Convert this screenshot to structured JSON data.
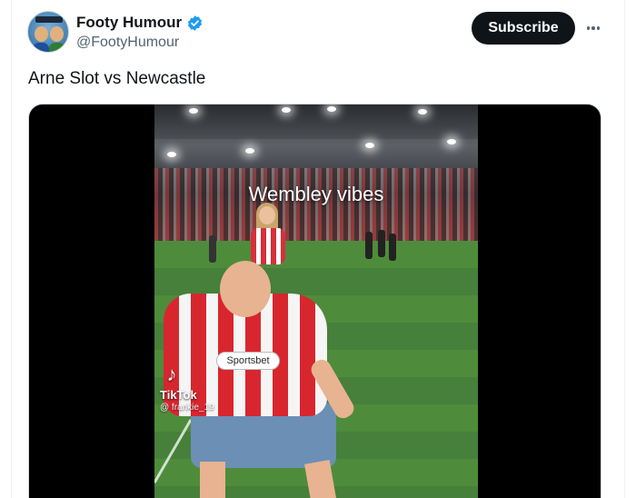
{
  "author": {
    "display_name": "Footy Humour",
    "handle": "@FootyHumour",
    "verified": true
  },
  "actions": {
    "subscribe_label": "Subscribe",
    "more_icon": "more-horizontal-icon"
  },
  "tweet": {
    "text": "Arne Slot vs Newcastle"
  },
  "video": {
    "overlay_caption": "Wembley vibes",
    "sponsor": "Sportsbet",
    "watermark": {
      "brand": "TikTok",
      "user": "@ frankie_19"
    }
  },
  "colors": {
    "subscribe_bg": "#0f1419",
    "verified_blue": "#1d9bf0",
    "handle_gray": "#536471"
  }
}
